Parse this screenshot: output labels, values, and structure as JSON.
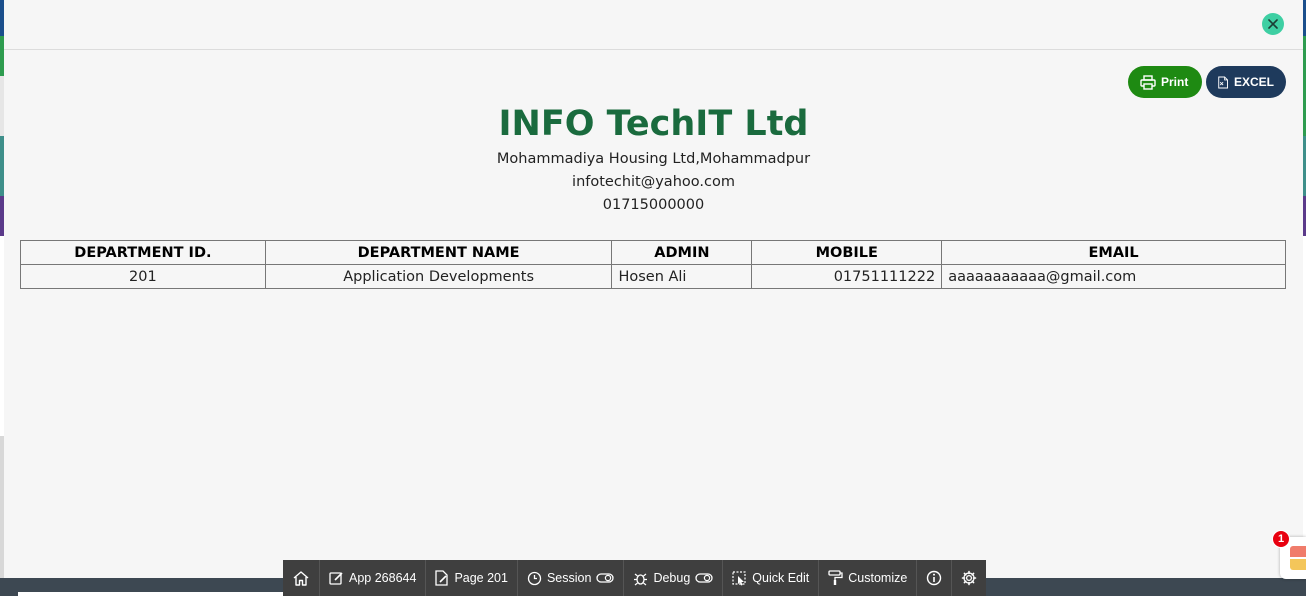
{
  "company": {
    "name": "INFO TechIT Ltd",
    "address": "Mohammadiya Housing Ltd,Mohammadpur",
    "email": "infotechit@yahoo.com",
    "phone": "01715000000"
  },
  "actions": {
    "print_label": "Print",
    "excel_label": "EXCEL"
  },
  "table": {
    "headers": [
      "DEPARTMENT ID.",
      "DEPARTMENT NAME",
      "ADMIN",
      "MOBILE",
      "EMAIL"
    ],
    "rows": [
      [
        "201",
        "Application Developments",
        "Hosen Ali",
        "01751111222",
        "aaaaaaaaaaa@gmail.com"
      ]
    ]
  },
  "dev_toolbar": {
    "app_label": "App 268644",
    "page_label": "Page 201",
    "session_label": "Session",
    "debug_label": "Debug",
    "quick_edit_label": "Quick Edit",
    "customize_label": "Customize"
  },
  "notification": {
    "count": "1"
  },
  "icons": {
    "close": "close-icon",
    "print": "printer-icon",
    "excel": "xls-file-icon",
    "home": "home-icon",
    "info": "info-icon",
    "settings": "gear-icon"
  },
  "colors": {
    "company_name": "#1a6b3e",
    "print_button": "#1e8a12",
    "excel_button": "#1e3a5c",
    "close_button": "#3ecfa3",
    "dev_toolbar": "#3f3f3f",
    "badge": "#e8000f"
  }
}
